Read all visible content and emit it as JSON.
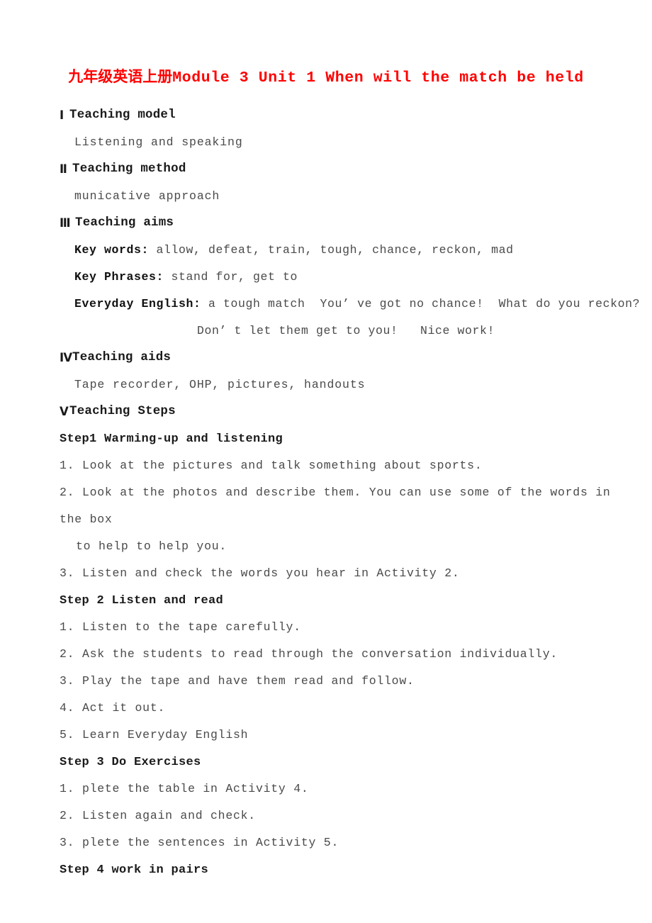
{
  "document": {
    "title_cn": "九年级英语上册",
    "title_en": "Module 3 Unit 1 When will the match be held",
    "title_color": "#ff0000",
    "body_color": "#4a4a4a",
    "heading_color": "#1a1a1a"
  },
  "sections": {
    "s1": {
      "numeral": "Ⅰ",
      "heading": "Teaching model",
      "body": "Listening and speaking"
    },
    "s2": {
      "numeral": "Ⅱ",
      "heading": "Teaching method",
      "body": "municative approach"
    },
    "s3": {
      "numeral": "Ⅲ",
      "heading": "Teaching aims",
      "key_words_label": "Key words:",
      "key_words_value": " allow, defeat, train, tough, chance, reckon, mad",
      "key_phrases_label": "Key Phrases:",
      "key_phrases_value": " stand for, get to",
      "everyday_label": "Everyday English:",
      "everyday_value": " a tough match  You’ ve got no chance!  What do you reckon?",
      "everyday_line2": "Don’ t let them get to you!   Nice work!"
    },
    "s4": {
      "numeral": "Ⅳ",
      "heading": "Teaching aids",
      "body": "Tape recorder, OHP, pictures, handouts"
    },
    "s5": {
      "numeral": "Ⅴ",
      "heading": "Teaching Steps"
    }
  },
  "steps": [
    {
      "heading": "Step1 Warming-up and listening",
      "items": [
        {
          "text": "1. Look at the pictures and talk something about sports."
        },
        {
          "text": "2. Look at the photos and describe them. You can use some of the words in the box",
          "cont": "to help to help you."
        },
        {
          "text": "3. Listen and check the words you hear in Activity 2."
        }
      ]
    },
    {
      "heading": "Step 2 Listen and read",
      "items": [
        {
          "text": "1. Listen to the tape carefully."
        },
        {
          "text": "2. Ask the students to read through the conversation individually."
        },
        {
          "text": "3. Play the tape and have them read and follow."
        },
        {
          "text": "4. Act it out."
        },
        {
          "text": "5. Learn Everyday English"
        }
      ]
    },
    {
      "heading": "Step 3 Do Exercises",
      "items": [
        {
          "text": "1. plete the table in Activity 4."
        },
        {
          "text": "2. Listen again and check."
        },
        {
          "text": "3. plete the sentences in Activity 5."
        }
      ]
    },
    {
      "heading": "Step 4 work in pairs",
      "items": []
    }
  ]
}
